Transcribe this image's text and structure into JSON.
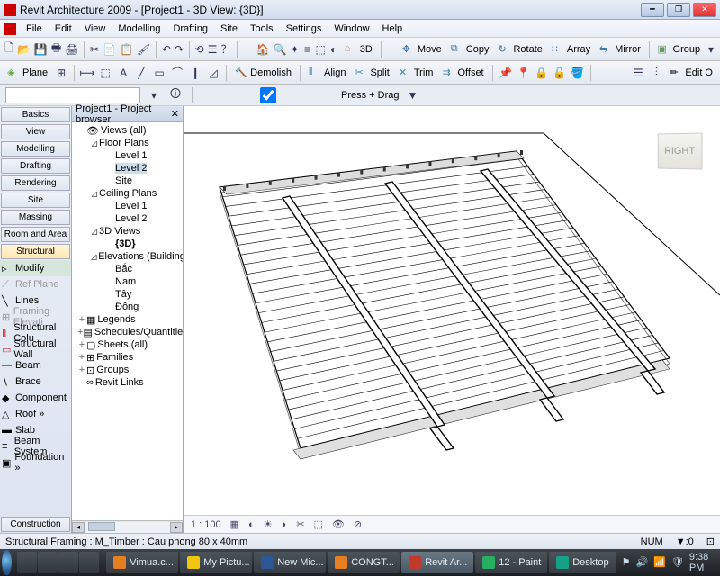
{
  "title": "Revit Architecture 2009 - [Project1 - 3D View: {3D}]",
  "menu": [
    "File",
    "Edit",
    "View",
    "Modelling",
    "Drafting",
    "Site",
    "Tools",
    "Settings",
    "Window",
    "Help"
  ],
  "toolbar2": {
    "plane": "Plane",
    "demolish": "Demolish",
    "align": "Align",
    "split": "Split",
    "trim": "Trim",
    "offset": "Offset",
    "edit": "Edit O"
  },
  "toolbar1": {
    "move": "Move",
    "copy": "Copy",
    "rotate": "Rotate",
    "array": "Array",
    "mirror": "Mirror",
    "group": "Group",
    "three_d": "3D"
  },
  "typesel": {
    "value": "",
    "pressdrag": "Press + Drag"
  },
  "designbar": {
    "tabs": [
      "Basics",
      "View",
      "Modelling",
      "Drafting",
      "Rendering",
      "Site",
      "Massing",
      "Room and Area",
      "Structural"
    ],
    "items": [
      {
        "label": "Modify",
        "ic": "▹"
      },
      {
        "label": "Ref Plane",
        "ic": "⟋"
      },
      {
        "label": "Lines",
        "ic": "╲"
      },
      {
        "label": "Framing Elevati",
        "ic": "⊞"
      },
      {
        "label": "Structural Colu",
        "ic": "Ⅱ"
      },
      {
        "label": "Structural Wall",
        "ic": "▭"
      },
      {
        "label": "Beam",
        "ic": "—"
      },
      {
        "label": "Brace",
        "ic": "∖"
      },
      {
        "label": "Component",
        "ic": "◆"
      },
      {
        "label": "Roof »",
        "ic": "△"
      },
      {
        "label": "Slab",
        "ic": "▬"
      },
      {
        "label": "Beam System",
        "ic": "≡"
      },
      {
        "label": "Foundation »",
        "ic": "▣"
      }
    ],
    "bottom_tab": "Construction"
  },
  "browser": {
    "title": "Project1 - Project browser",
    "tree": [
      {
        "lvl": 1,
        "exp": "−",
        "label": "Views (all)",
        "ic": "👁"
      },
      {
        "lvl": 2,
        "exp": "⊿",
        "label": "Floor Plans"
      },
      {
        "lvl": 3,
        "exp": "",
        "label": "Level 1"
      },
      {
        "lvl": 3,
        "exp": "",
        "label": "Level 2",
        "sel": true
      },
      {
        "lvl": 3,
        "exp": "",
        "label": "Site"
      },
      {
        "lvl": 2,
        "exp": "⊿",
        "label": "Ceiling Plans"
      },
      {
        "lvl": 3,
        "exp": "",
        "label": "Level 1"
      },
      {
        "lvl": 3,
        "exp": "",
        "label": "Level 2"
      },
      {
        "lvl": 2,
        "exp": "⊿",
        "label": "3D Views"
      },
      {
        "lvl": 3,
        "exp": "",
        "label": "{3D}",
        "bold": true
      },
      {
        "lvl": 2,
        "exp": "⊿",
        "label": "Elevations (Building"
      },
      {
        "lvl": 3,
        "exp": "",
        "label": "Bắc"
      },
      {
        "lvl": 3,
        "exp": "",
        "label": "Nam"
      },
      {
        "lvl": 3,
        "exp": "",
        "label": "Tây"
      },
      {
        "lvl": 3,
        "exp": "",
        "label": "Đông"
      },
      {
        "lvl": 1,
        "exp": "+",
        "label": "Legends",
        "ic": "▦"
      },
      {
        "lvl": 1,
        "exp": "+",
        "label": "Schedules/Quantitie",
        "ic": "▤"
      },
      {
        "lvl": 1,
        "exp": "+",
        "label": "Sheets (all)",
        "ic": "▢"
      },
      {
        "lvl": 1,
        "exp": "+",
        "label": "Families",
        "ic": "⊞"
      },
      {
        "lvl": 1,
        "exp": "+",
        "label": "Groups",
        "ic": "⊡"
      },
      {
        "lvl": 1,
        "exp": "",
        "label": "Revit Links",
        "ic": "∞"
      }
    ]
  },
  "viewcube": "RIGHT",
  "viewcontrol": {
    "scale": "1 : 100"
  },
  "status": {
    "left": "Structural Framing : M_Timber : Cau phong 80 x 40mm",
    "num": "NUM",
    "filter": "▼:0"
  },
  "taskbar": {
    "tasks": [
      {
        "label": "Vimua.c...",
        "ic": "#e67e22"
      },
      {
        "label": "My Pictu...",
        "ic": "#f1c40f"
      },
      {
        "label": "New Mic...",
        "ic": "#2b5797"
      },
      {
        "label": "CONGT...",
        "ic": "#e67e22"
      },
      {
        "label": "Revit Ar...",
        "ic": "#c0392b",
        "active": true
      },
      {
        "label": "12 - Paint",
        "ic": "#27ae60"
      },
      {
        "label": "Desktop",
        "ic": "#16a085"
      }
    ],
    "time": "9:38 PM"
  }
}
